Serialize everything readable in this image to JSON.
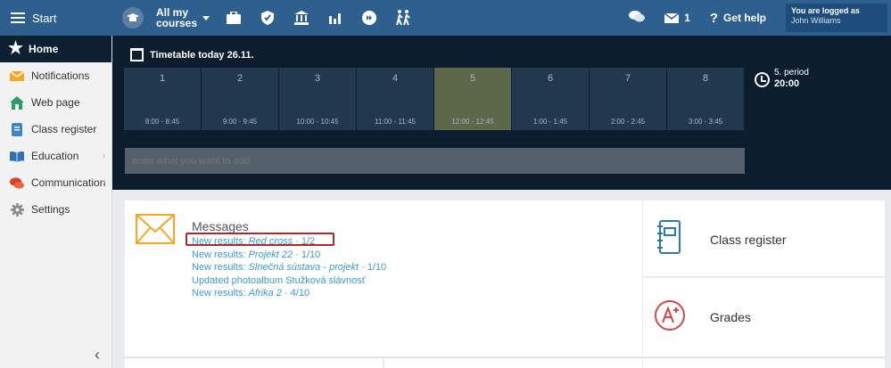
{
  "topbar": {
    "start_label": "Start",
    "courses_label_line1": "All my",
    "courses_label_line2": "courses",
    "messages_count": "1",
    "help_label": "Get help",
    "logged_in_line1": "You are logged as",
    "logged_in_line2": "John Williams",
    "colors": {
      "bar": "#2d5f8f",
      "logged_box": "#1e4d7b"
    }
  },
  "sidebar": {
    "home": "Home",
    "items": [
      {
        "label": "Notifications",
        "icon": "envelope-icon"
      },
      {
        "label": "Web page",
        "icon": "house-icon"
      },
      {
        "label": "Class register",
        "icon": "notebook-icon"
      },
      {
        "label": "Education",
        "icon": "book-icon"
      },
      {
        "label": "Communication",
        "icon": "chat-icon"
      },
      {
        "label": "Settings",
        "icon": "gear-icon"
      }
    ]
  },
  "timetable": {
    "title": "Timetable today 26.11.",
    "periods": [
      {
        "num": "1",
        "time": "8:00 - 8:45"
      },
      {
        "num": "2",
        "time": "9:00 - 9:45"
      },
      {
        "num": "3",
        "time": "10:00 - 10:45"
      },
      {
        "num": "4",
        "time": "11:00 - 11:45"
      },
      {
        "num": "5",
        "time": "12:00 - 12:45"
      },
      {
        "num": "6",
        "time": "1:00 - 1:45"
      },
      {
        "num": "7",
        "time": "2:00 - 2:45"
      },
      {
        "num": "8",
        "time": "3:00 - 3:45"
      }
    ],
    "current_period": "5. period",
    "current_time": "20:00",
    "add_placeholder": "enter what you want to add"
  },
  "messages": {
    "heading": "Messages",
    "items": [
      {
        "prefix": "New results: ",
        "name": "Red cross",
        "suffix": " · 1/2"
      },
      {
        "prefix": "New results: ",
        "name": "Projekt 22",
        "suffix": " · 1/10"
      },
      {
        "prefix": "New results: ",
        "name": "Slnečná sústava - projekt",
        "suffix": " · 1/10"
      },
      {
        "prefix": "Updated photoalbum Stužková slávnosť",
        "name": "",
        "suffix": ""
      },
      {
        "prefix": "New results: ",
        "name": "Afrika 2",
        "suffix": " · 4/10"
      }
    ]
  },
  "tiles": {
    "class_register": "Class register",
    "grades": "Grades"
  }
}
